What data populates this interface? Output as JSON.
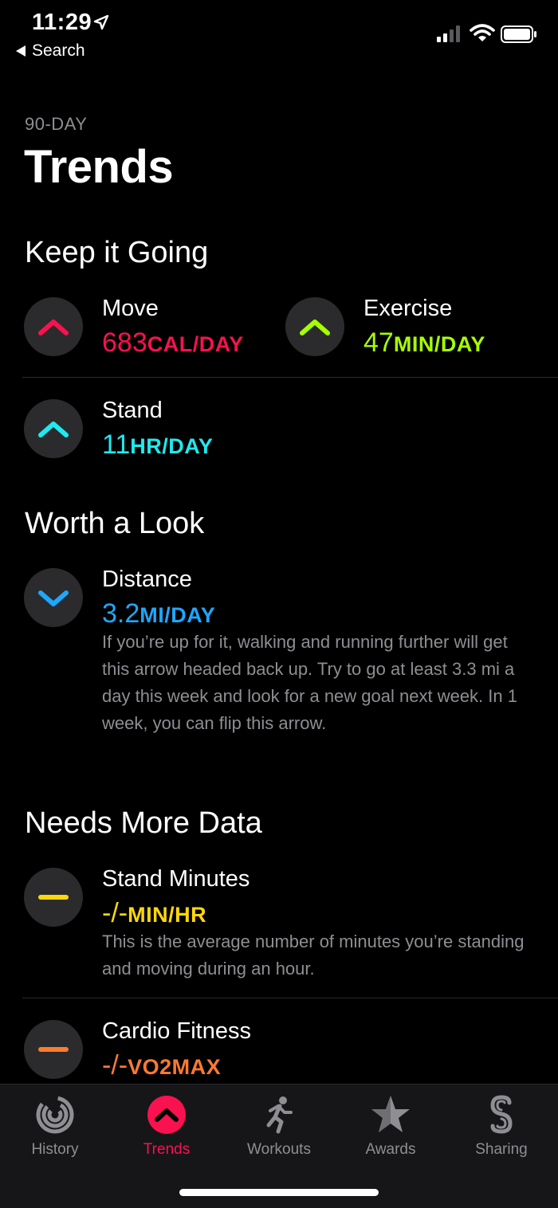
{
  "status_bar": {
    "time": "11:29",
    "back_label": "Search"
  },
  "header": {
    "eyebrow": "90-DAY",
    "title": "Trends"
  },
  "sections": {
    "keep_going": "Keep it Going",
    "worth_look": "Worth a Look",
    "needs_data": "Needs More Data"
  },
  "trends": {
    "move": {
      "label": "Move",
      "value": "683",
      "unit": "CAL/DAY",
      "color": "#fa114f",
      "icon": "chevron-up-icon"
    },
    "exercise": {
      "label": "Exercise",
      "value": "47",
      "unit": "MIN/DAY",
      "color": "#a6ff00",
      "icon": "chevron-up-icon"
    },
    "stand": {
      "label": "Stand",
      "value": "11",
      "unit": "HR/DAY",
      "color": "#1eeaef",
      "icon": "chevron-up-icon"
    },
    "distance": {
      "label": "Distance",
      "value": "3.2",
      "unit": "MI/DAY",
      "color": "#1ea7fd",
      "icon": "chevron-down-icon",
      "description": "If you’re up for it, walking and running further will get this arrow headed back up. Try to go at least 3.3 mi a day this week and look for a new goal next week. In 1 week, you can flip this arrow."
    },
    "stand_minutes": {
      "label": "Stand Minutes",
      "value": "-/-",
      "unit": "MIN/HR",
      "color": "#ffd60a",
      "icon": "dash-icon",
      "description": "This is the average number of minutes you’re standing and moving during an hour."
    },
    "cardio": {
      "label": "Cardio Fitness",
      "value": "-/-",
      "unit": "VO2MAX",
      "color": "#ff7a30",
      "icon": "dash-icon"
    }
  },
  "tabs": [
    {
      "label": "History",
      "icon": "history-rings-icon"
    },
    {
      "label": "Trends",
      "icon": "trends-chevron-icon",
      "active": true
    },
    {
      "label": "Workouts",
      "icon": "running-figure-icon"
    },
    {
      "label": "Awards",
      "icon": "star-icon"
    },
    {
      "label": "Sharing",
      "icon": "sharing-s-icon"
    }
  ]
}
